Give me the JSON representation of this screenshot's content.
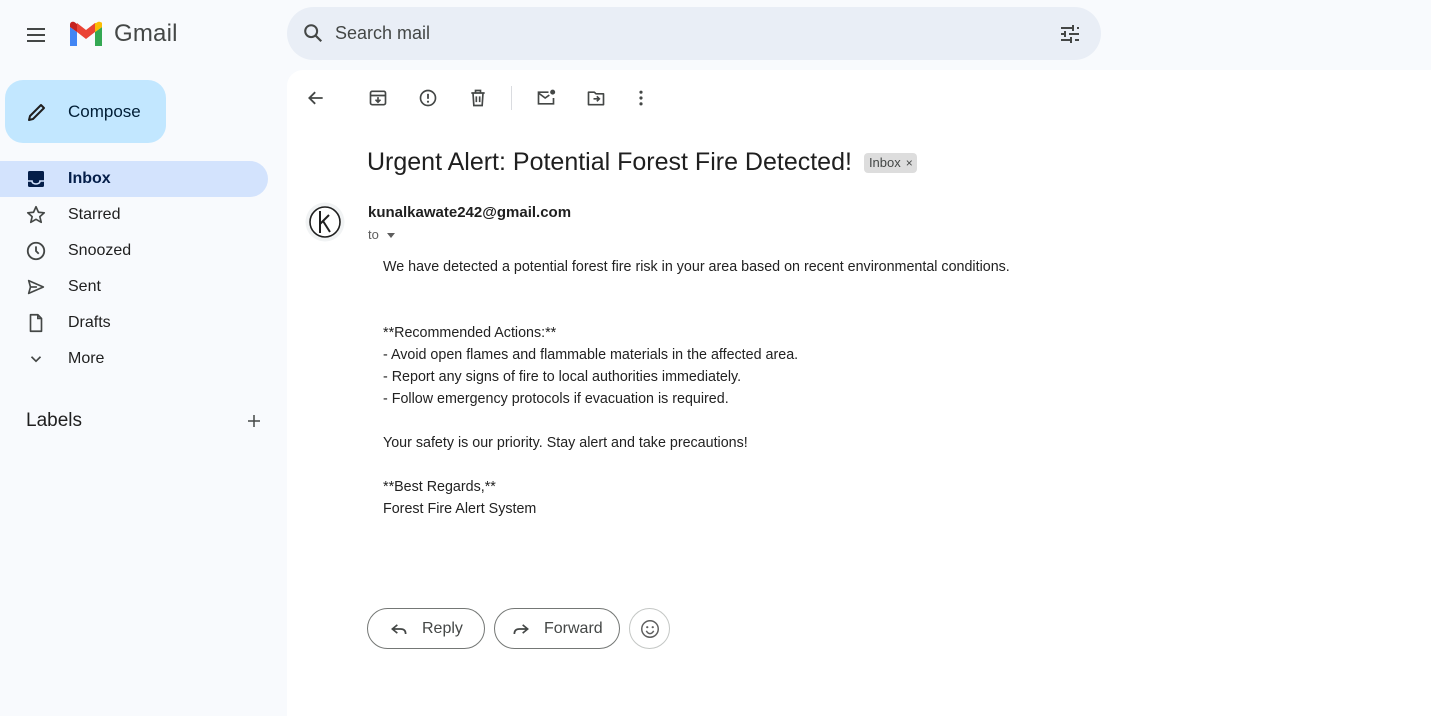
{
  "app": {
    "name": "Gmail"
  },
  "search": {
    "placeholder": "Search mail"
  },
  "sidebar": {
    "compose_label": "Compose",
    "items": [
      {
        "label": "Inbox",
        "icon": "inbox-icon",
        "active": true
      },
      {
        "label": "Starred",
        "icon": "star-icon"
      },
      {
        "label": "Snoozed",
        "icon": "clock-icon"
      },
      {
        "label": "Sent",
        "icon": "send-icon"
      },
      {
        "label": "Drafts",
        "icon": "draft-icon"
      },
      {
        "label": "More",
        "icon": "chevron-down-icon"
      }
    ],
    "labels_title": "Labels"
  },
  "toolbar": {
    "icons": [
      "back-arrow-icon",
      "archive-icon",
      "report-spam-icon",
      "delete-icon",
      "mark-unread-icon",
      "move-to-icon",
      "more-vert-icon"
    ]
  },
  "email": {
    "subject": "Urgent Alert: Potential Forest Fire Detected!",
    "label_chip": "Inbox",
    "label_chip_close": "×",
    "sender": "kunalkawate242@gmail.com",
    "to_label": "to",
    "body_lines": [
      "We have detected a potential forest fire risk in your area based on recent environmental conditions.",
      "",
      "",
      "**Recommended Actions:**",
      "- Avoid open flames and flammable materials in the affected area.",
      "- Report any signs of fire to local authorities immediately.",
      "- Follow emergency protocols if evacuation is required.",
      "",
      "Your safety is our priority. Stay alert and take precautions!",
      "",
      "**Best Regards,**",
      "Forest Fire Alert System"
    ]
  },
  "actions": {
    "reply_label": "Reply",
    "forward_label": "Forward"
  },
  "colors": {
    "compose_bg": "#c2e7ff",
    "active_nav_bg": "#d3e3fd",
    "search_bg": "#e9eef6",
    "page_bg": "#f8fafd"
  }
}
